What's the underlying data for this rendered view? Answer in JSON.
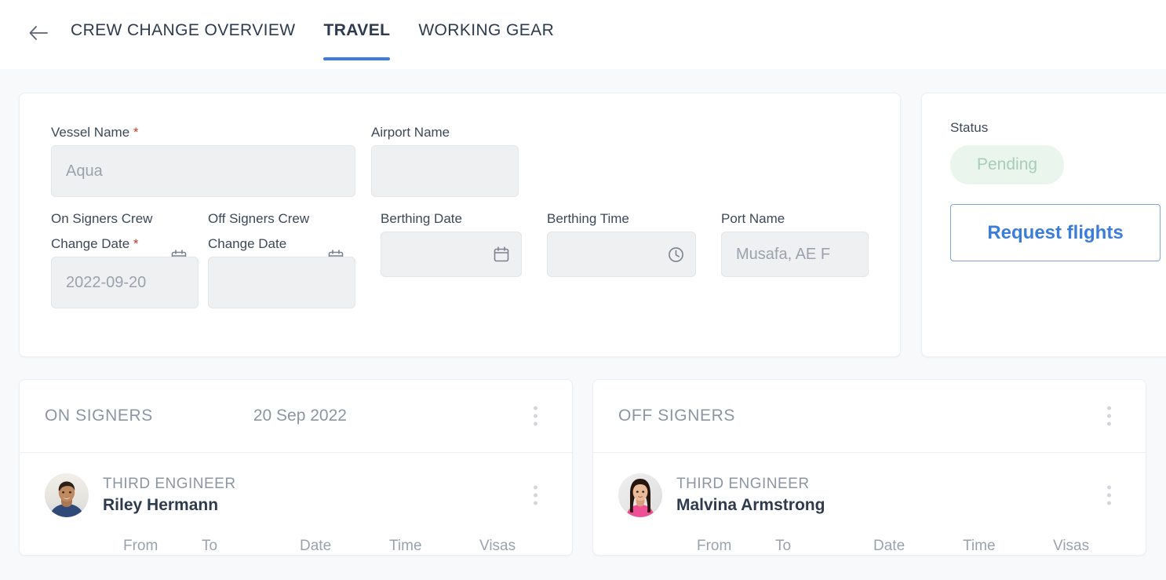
{
  "header": {
    "back_icon": "arrow-left-icon",
    "breadcrumb": "CREW CHANGE OVERVIEW",
    "tabs": [
      {
        "label": "TRAVEL",
        "active": true
      },
      {
        "label": "WORKING GEAR",
        "active": false
      }
    ],
    "accent_color": "#3b7dd8"
  },
  "form": {
    "vessel": {
      "label": "Vessel Name",
      "required": "*",
      "value": "Aqua",
      "placeholder": "Aqua"
    },
    "airport": {
      "label": "Airport Name",
      "value": "",
      "placeholder": ""
    },
    "on_signers_date": {
      "label_line1": "On Signers Crew",
      "label_line2": "Change Date",
      "required": "*",
      "value": "2022-09-20",
      "icon": "calendar-icon"
    },
    "off_signers_date": {
      "label_line1": "Off Signers Crew",
      "label_line2": "Change Date",
      "value": "",
      "icon": "calendar-icon"
    },
    "berthing_date": {
      "label": "Berthing Date",
      "value": "",
      "icon": "calendar-icon"
    },
    "berthing_time": {
      "label": "Berthing Time",
      "value": "",
      "icon": "clock-icon"
    },
    "port": {
      "label": "Port Name",
      "value": "Musafa, AE F",
      "placeholder": "Musafa, AE F"
    }
  },
  "status_panel": {
    "label": "Status",
    "badge": "Pending",
    "badge_bg": "#e9f5ed",
    "badge_color": "#a9cdb6",
    "button": "Request flights",
    "button_color": "#3b7dd8"
  },
  "on_signers": {
    "title": "ON SIGNERS",
    "date": "20 Sep 2022",
    "menu_icon": "kebab-menu-icon",
    "members": [
      {
        "role": "THIRD ENGINEER",
        "name": "Riley Hermann",
        "avatar": "male-portrait-avatar",
        "menu_icon": "kebab-menu-icon"
      }
    ],
    "columns": [
      "From",
      "To",
      "Date",
      "Time",
      "Visas"
    ]
  },
  "off_signers": {
    "title": "OFF SIGNERS",
    "date": "",
    "menu_icon": "kebab-menu-icon",
    "members": [
      {
        "role": "THIRD ENGINEER",
        "name": "Malvina Armstrong",
        "avatar": "female-portrait-avatar",
        "menu_icon": "kebab-menu-icon"
      }
    ],
    "columns": [
      "From",
      "To",
      "Date",
      "Time",
      "Visas"
    ]
  }
}
